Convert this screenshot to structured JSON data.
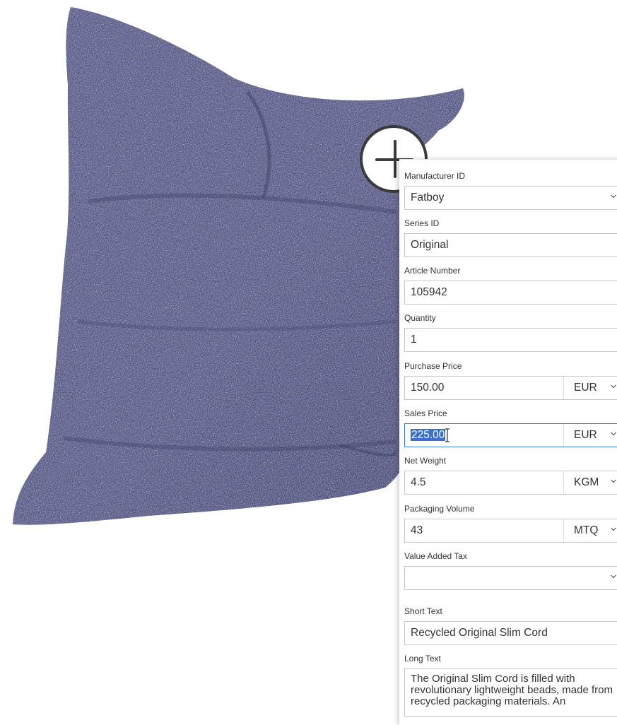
{
  "form": {
    "manufacturer_id": {
      "label": "Manufacturer ID",
      "value": "Fatboy"
    },
    "series_id": {
      "label": "Series ID",
      "value": "Original"
    },
    "article_number": {
      "label": "Article Number",
      "value": "105942"
    },
    "quantity": {
      "label": "Quantity",
      "value": "1"
    },
    "purchase_price": {
      "label": "Purchase Price",
      "value": "150.00",
      "currency": "EUR"
    },
    "sales_price": {
      "label": "Sales Price",
      "value": "225.00",
      "currency": "EUR"
    },
    "net_weight": {
      "label": "Net Weight",
      "value": "4.5",
      "unit": "KGM"
    },
    "packaging_volume": {
      "label": "Packaging Volume",
      "value": "43",
      "unit": "MTQ"
    },
    "value_added_tax": {
      "label": "Value Added Tax",
      "value": ""
    },
    "short_text": {
      "label": "Short Text",
      "value": "Recycled Original Slim Cord"
    },
    "long_text": {
      "label": "Long Text",
      "value": "The Original Slim Cord is filled with revolutionary lightweight beads, made from recycled packaging materials. An"
    }
  },
  "colors": {
    "product_fabric": "#5a5c8a",
    "focus_border": "#3a7bd5",
    "selection": "#3b6fd0"
  },
  "icons": {
    "zoom": "plus-circle-icon",
    "dropdown": "chevron-down-icon",
    "cursor": "text-cursor-icon"
  }
}
